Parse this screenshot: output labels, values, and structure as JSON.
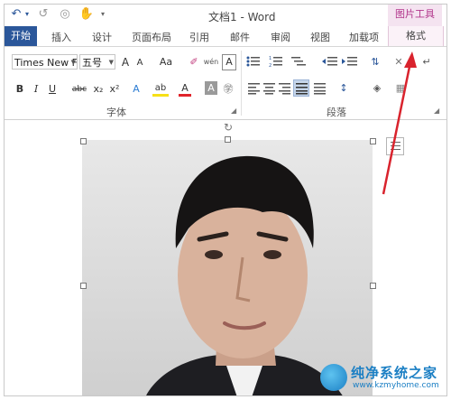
{
  "quick_access": {
    "undo_glyph": "↶",
    "redo_glyph": "↺",
    "circle_glyph": "◎",
    "touch_glyph": "✋",
    "more_glyph": "▾"
  },
  "window": {
    "title": "文档1 - Word"
  },
  "context_tab": {
    "group_title": "图片工具",
    "tab_label": "格式"
  },
  "tabs": [
    {
      "label": "开始",
      "active": true
    },
    {
      "label": "插入"
    },
    {
      "label": "设计"
    },
    {
      "label": "页面布局"
    },
    {
      "label": "引用"
    },
    {
      "label": "邮件"
    },
    {
      "label": "审阅"
    },
    {
      "label": "视图"
    },
    {
      "label": "加载项"
    }
  ],
  "font_group": {
    "font_name": "Times New F",
    "font_size": "五号",
    "grow_label": "A",
    "shrink_label": "A",
    "case_label": "Aa",
    "clear_glyph": "✐",
    "phonetic_label": "wén",
    "border_label": "A",
    "bold": "B",
    "italic": "I",
    "underline": "U",
    "strike": "abc",
    "subscript": "x₂",
    "superscript": "x²",
    "effects": "A",
    "highlight": "ab",
    "color": "A",
    "shade": "A",
    "enclose": "㊫",
    "label": "字体"
  },
  "paragraph_group": {
    "label": "段落"
  },
  "colors": {
    "accent": "#2b579a",
    "context_pink": "#b2368c",
    "arrow_red": "#d9232d",
    "font_red": "#e0242b",
    "highlight_yellow": "#f6e017"
  },
  "watermark": {
    "cn": "纯净系统之家",
    "en": "www.kzmyhome.com"
  }
}
